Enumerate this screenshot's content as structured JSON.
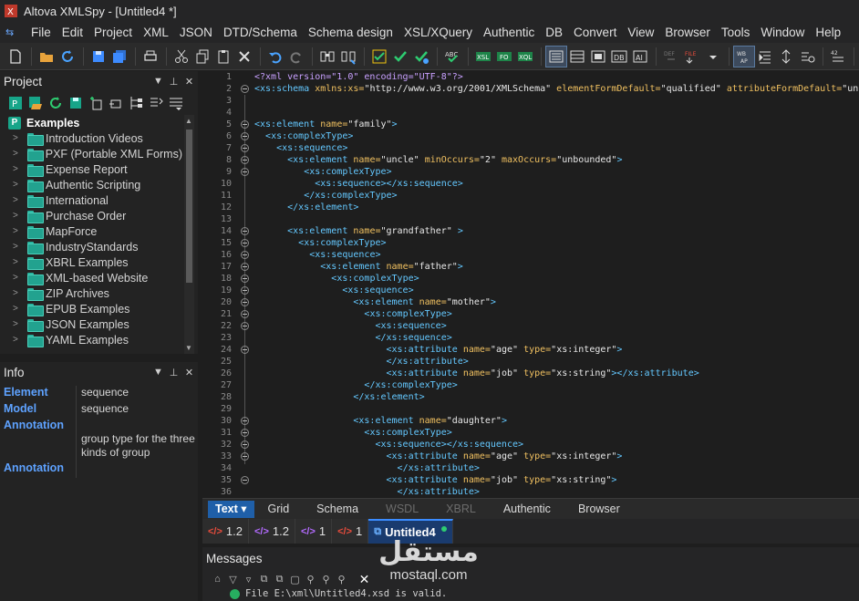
{
  "window": {
    "title": "Altova XMLSpy - [Untitled4 *]"
  },
  "menubar": {
    "items": [
      "File",
      "Edit",
      "Project",
      "XML",
      "JSON",
      "DTD/Schema",
      "Schema design",
      "XSL/XQuery",
      "Authentic",
      "DB",
      "Convert",
      "View",
      "Browser",
      "Tools",
      "Window",
      "Help"
    ]
  },
  "project": {
    "title": "Project",
    "root": "Examples",
    "items": [
      "Introduction Videos",
      "PXF (Portable XML Forms)",
      "Expense Report",
      "Authentic Scripting",
      "International",
      "Purchase Order",
      "MapForce",
      "IndustryStandards",
      "XBRL Examples",
      "XML-based Website",
      "ZIP Archives",
      "EPUB Examples",
      "JSON Examples",
      "YAML Examples"
    ]
  },
  "info": {
    "title": "Info",
    "rows": [
      {
        "key": "Element",
        "value": "sequence"
      },
      {
        "key": "Model",
        "value": "sequence"
      },
      {
        "key": "Annotation",
        "value": "group type for the three kinds of group"
      },
      {
        "key": "Annotation",
        "value": ""
      }
    ]
  },
  "editor": {
    "line_numbers": [
      "1",
      "2",
      "3",
      "4",
      "5",
      "6",
      "7",
      "8",
      "9",
      "10",
      "11",
      "12",
      "13",
      "14",
      "15",
      "16",
      "17",
      "18",
      "19",
      "20",
      "21",
      "22",
      "23",
      "24",
      "25",
      "26",
      "27",
      "28",
      "29",
      "30",
      "31",
      "32",
      "33",
      "34",
      "35",
      "36"
    ]
  },
  "view_tabs": [
    {
      "label": "Text",
      "active": true
    },
    {
      "label": "Grid"
    },
    {
      "label": "Schema"
    },
    {
      "label": "WSDL",
      "disabled": true
    },
    {
      "label": "XBRL",
      "disabled": true
    },
    {
      "label": "Authentic"
    },
    {
      "label": "Browser"
    }
  ],
  "doc_tabs": [
    {
      "label": "1.2",
      "icon": "xml-red"
    },
    {
      "label": "1.2",
      "icon": "xml-purple"
    },
    {
      "label": "1",
      "icon": "xml-purple"
    },
    {
      "label": "1",
      "icon": "xml-red"
    },
    {
      "label": "Untitled4",
      "active": true
    }
  ],
  "messages": {
    "title": "Messages",
    "line": "File E:\\xml\\Untitled4.xsd is valid."
  },
  "watermark": {
    "arabic": "مستقل",
    "latin": "mostaql.com"
  },
  "colors": {
    "accent": "#1f5fa8",
    "tag": "#64c8ff",
    "attr": "#f0c060",
    "valid": "#27ae60"
  }
}
